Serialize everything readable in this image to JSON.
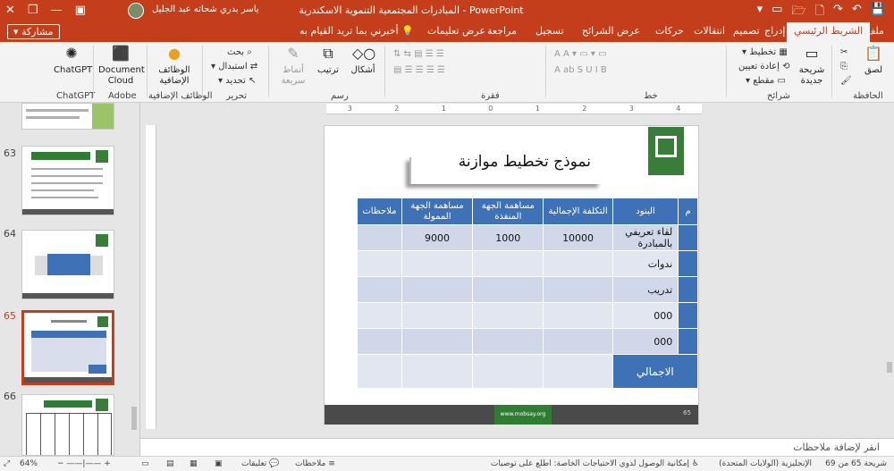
{
  "window": {
    "doc_title": "المبادرات المجتمعية التنموية الاسكندرية",
    "app_name": "PowerPoint",
    "separator": "-",
    "user_name": "ياسر بدري شحاته عبد الجليل"
  },
  "tabs": {
    "file": "ملف",
    "home": "الشريط الرئيسي",
    "insert": "إدراج",
    "design": "تصميم",
    "transitions": "انتقالات",
    "animations": "حركات",
    "slideshow": "عرض الشرائح",
    "record": "تسجيل",
    "review": "مراجعة",
    "view": "عرض",
    "help": "تعليمات",
    "tellme": "أخبرني بما تريد القيام به",
    "share": "مشاركة"
  },
  "ribbon": {
    "clipboard": {
      "label": "الحافظة",
      "paste": "لصق"
    },
    "slides": {
      "label": "شرائح",
      "new_slide": "شريحة",
      "new_slide2": "جديدة",
      "layout": "تخطيط",
      "reset": "إعادة تعيين",
      "section": "مقطع"
    },
    "font": {
      "label": "خط"
    },
    "paragraph": {
      "label": "فقرة"
    },
    "drawing": {
      "label": "رسم",
      "shapes": "أشكال",
      "arrange": "ترتيب",
      "styles": "أنماط",
      "styles2": "سريعة"
    },
    "editing": {
      "label": "تحرير",
      "find": "بحث",
      "replace": "استبدال",
      "select": "تحديد"
    },
    "addins": {
      "label": "الوظائف الإضافية",
      "btn": "الوظائف",
      "btn2": "الإضافية"
    },
    "adobe": {
      "label": "Adobe",
      "btn": "Document",
      "btn2": "Cloud"
    },
    "chatgpt": {
      "label": "ChatGPT",
      "btn": "ChatGPT"
    }
  },
  "thumbnails": [
    "63",
    "64",
    "65",
    "66"
  ],
  "slide": {
    "title": "نموذج تخطيط موازنة",
    "headers": [
      "م",
      "البنود",
      "التكلفة الإجمالية",
      "مساهمة الجهة المنفذة",
      "مساهمة الجهة الممولة",
      "ملاحظات"
    ],
    "rows": [
      {
        "item": "لقاء تعريفي بالمبادرة",
        "total": "10000",
        "implementer": "1000",
        "funder": "9000"
      },
      {
        "item": "ندوات",
        "total": "",
        "implementer": "",
        "funder": ""
      },
      {
        "item": "تدريب",
        "total": "",
        "implementer": "",
        "funder": ""
      },
      {
        "item": "000",
        "total": "",
        "implementer": "",
        "funder": ""
      },
      {
        "item": "000",
        "total": "",
        "implementer": "",
        "funder": ""
      }
    ],
    "total_label": "الاجمالي",
    "footer_site": "www.mobsay.org",
    "footer_page": "65"
  },
  "notes": {
    "placeholder": "انقر لإضافة ملاحظات"
  },
  "status": {
    "slide_info": "شريحة 65 من 69",
    "language": "الإنجليزية (الولايات المتحدة)",
    "accessibility": "إمكانية الوصول لذوي الاحتياجات الخاصة: اطلع على توصيات",
    "notes": "ملاحظات",
    "comments": "تعليقات",
    "zoom": "64%"
  }
}
